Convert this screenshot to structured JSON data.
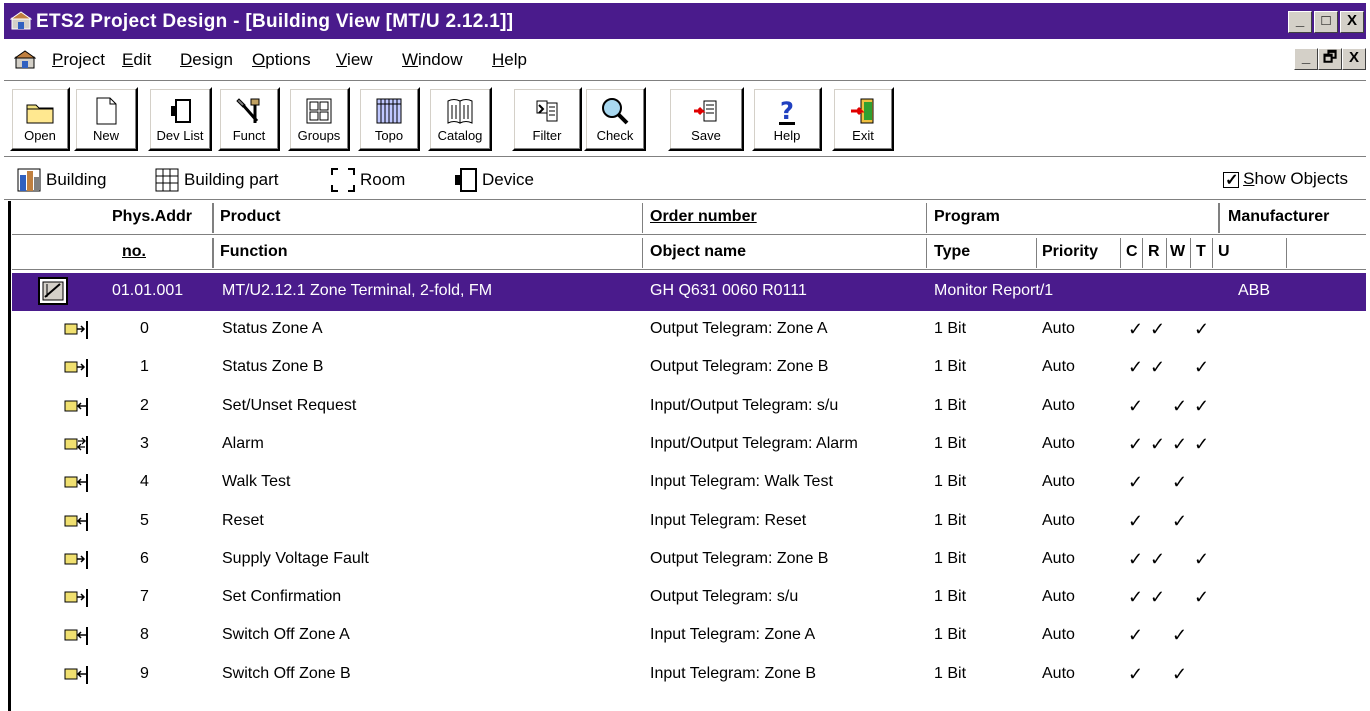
{
  "window": {
    "title": "ETS2 Project Design - [Building View [MT/U 2.12.1]]",
    "controls": {
      "minimize": "_",
      "maximize": "□",
      "close": "X"
    }
  },
  "menu": {
    "items": [
      {
        "label": "Project",
        "underline": "P",
        "rest": "roject"
      },
      {
        "label": "Edit",
        "underline": "E",
        "rest": "dit"
      },
      {
        "label": "Design",
        "underline": "D",
        "rest": "esign"
      },
      {
        "label": "Options",
        "underline": "O",
        "rest": "ptions"
      },
      {
        "label": "View",
        "underline": "V",
        "rest": "iew"
      },
      {
        "label": "Window",
        "underline": "W",
        "rest": "indow"
      },
      {
        "label": "Help",
        "underline": "H",
        "rest": "elp"
      }
    ],
    "mdi_controls": {
      "minimize": "_",
      "restore": "🗗",
      "close": "X"
    }
  },
  "toolbar": {
    "buttons": [
      {
        "label": "Open",
        "icon": "folder-icon"
      },
      {
        "label": "New",
        "icon": "new-document-icon"
      },
      {
        "label": "Dev List",
        "icon": "device-list-icon"
      },
      {
        "label": "Funct",
        "icon": "tools-icon"
      },
      {
        "label": "Groups",
        "icon": "groups-icon"
      },
      {
        "label": "Topo",
        "icon": "topology-icon"
      },
      {
        "label": "Catalog",
        "icon": "catalog-book-icon"
      },
      {
        "label": "Filter",
        "icon": "filter-icon"
      },
      {
        "label": "Check",
        "icon": "magnifier-icon"
      },
      {
        "label": "Save",
        "icon": "save-icon"
      },
      {
        "label": "Help",
        "icon": "help-question-icon"
      },
      {
        "label": "Exit",
        "icon": "exit-door-icon"
      }
    ]
  },
  "objects_bar": {
    "items": [
      {
        "label": "Building",
        "icon": "building-icon"
      },
      {
        "label": "Building part",
        "icon": "building-part-icon"
      },
      {
        "label": "Room",
        "icon": "room-icon"
      },
      {
        "label": "Device",
        "icon": "device-icon"
      }
    ],
    "show_objects": {
      "label_u": "S",
      "label_rest": "how Objects",
      "checked": true
    }
  },
  "table": {
    "header1": {
      "phys_addr": "Phys.Addr",
      "product": "Product",
      "order_number": "Order number",
      "program": "Program",
      "manufacturer": "Manufacturer"
    },
    "header2": {
      "no": "no.",
      "function": "Function",
      "object_name": "Object name",
      "type": "Type",
      "priority": "Priority",
      "c": "C",
      "r": "R",
      "w": "W",
      "t": "T",
      "u": "U"
    },
    "device_row": {
      "address": "01.01.001",
      "product": "MT/U2.12.1 Zone Terminal, 2-fold, FM",
      "order_number": "GH Q631 0060 R0111",
      "program": "Monitor Report/1",
      "manufacturer": "ABB"
    },
    "rows": [
      {
        "no": "0",
        "function": "Status Zone A",
        "object": "Output Telegram: Zone A",
        "type": "1 Bit",
        "priority": "Auto",
        "icon": "output-object-icon",
        "flags": [
          1,
          1,
          0,
          1,
          0
        ]
      },
      {
        "no": "1",
        "function": "Status Zone B",
        "object": "Output Telegram: Zone B",
        "type": "1 Bit",
        "priority": "Auto",
        "icon": "output-object-icon",
        "flags": [
          1,
          1,
          0,
          1,
          0
        ]
      },
      {
        "no": "2",
        "function": "Set/Unset Request",
        "object": "Input/Output Telegram: s/u",
        "type": "1 Bit",
        "priority": "Auto",
        "icon": "input-object-icon",
        "flags": [
          1,
          0,
          1,
          1,
          0
        ]
      },
      {
        "no": "3",
        "function": "Alarm",
        "object": "Input/Output Telegram: Alarm",
        "type": "1 Bit",
        "priority": "Auto",
        "icon": "input-output-object-icon",
        "flags": [
          1,
          1,
          1,
          1,
          0
        ]
      },
      {
        "no": "4",
        "function": "Walk Test",
        "object": "Input Telegram: Walk Test",
        "type": "1 Bit",
        "priority": "Auto",
        "icon": "input-object-icon",
        "flags": [
          1,
          0,
          1,
          0,
          0
        ]
      },
      {
        "no": "5",
        "function": "Reset",
        "object": "Input Telegram: Reset",
        "type": "1 Bit",
        "priority": "Auto",
        "icon": "input-object-icon",
        "flags": [
          1,
          0,
          1,
          0,
          0
        ]
      },
      {
        "no": "6",
        "function": "Supply Voltage Fault",
        "object": "Output Telegram: Zone B",
        "type": "1 Bit",
        "priority": "Auto",
        "icon": "output-object-icon",
        "flags": [
          1,
          1,
          0,
          1,
          0
        ]
      },
      {
        "no": "7",
        "function": "Set Confirmation",
        "object": "Output Telegram: s/u",
        "type": "1 Bit",
        "priority": "Auto",
        "icon": "output-object-icon",
        "flags": [
          1,
          1,
          0,
          1,
          0
        ]
      },
      {
        "no": "8",
        "function": "Switch Off Zone A",
        "object": "Input Telegram: Zone A",
        "type": "1 Bit",
        "priority": "Auto",
        "icon": "input-object-icon",
        "flags": [
          1,
          0,
          1,
          0,
          0
        ]
      },
      {
        "no": "9",
        "function": "Switch Off Zone B",
        "object": "Input Telegram: Zone B",
        "type": "1 Bit",
        "priority": "Auto",
        "icon": "input-object-icon",
        "flags": [
          1,
          0,
          1,
          0,
          0
        ]
      }
    ],
    "tick_glyph": "✓"
  },
  "colors": {
    "title_bar": "#4a1b8c",
    "selection": "#4a1b8c"
  }
}
